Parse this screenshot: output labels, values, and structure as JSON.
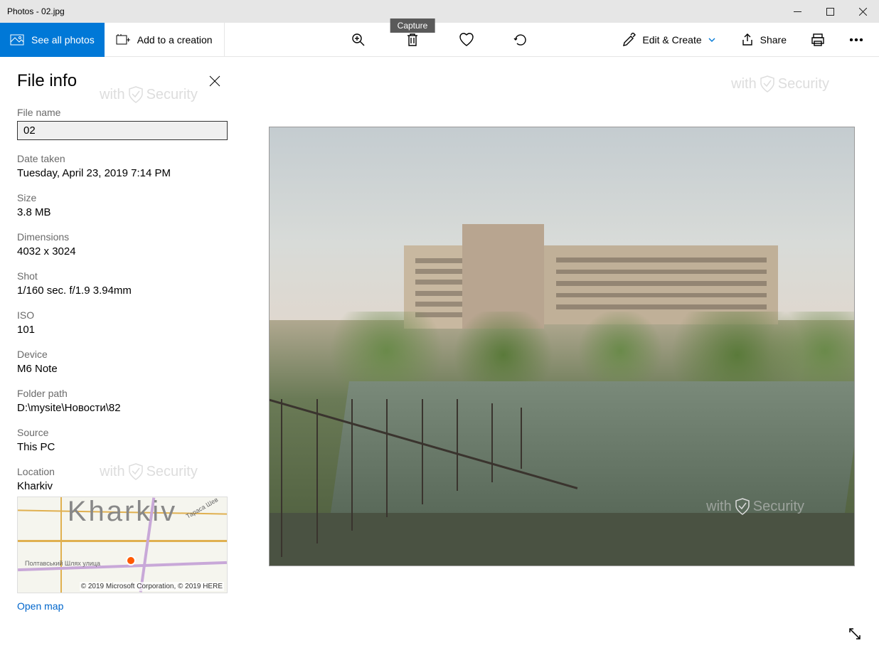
{
  "titlebar": {
    "title": "Photos - 02.jpg"
  },
  "toolbar": {
    "see_all": "See all photos",
    "add_creation": "Add to a creation",
    "capture_tooltip": "Capture",
    "edit_create": "Edit & Create",
    "share": "Share"
  },
  "fileinfo": {
    "title": "File info",
    "filename_label": "File name",
    "filename_value": "02",
    "date_label": "Date taken",
    "date_value": "Tuesday, April 23, 2019 7:14 PM",
    "size_label": "Size",
    "size_value": "3.8 MB",
    "dimensions_label": "Dimensions",
    "dimensions_value": "4032 x 3024",
    "shot_label": "Shot",
    "shot_value": "1/160 sec. f/1.9 3.94mm",
    "iso_label": "ISO",
    "iso_value": "101",
    "device_label": "Device",
    "device_value": "M6 Note",
    "folder_label": "Folder path",
    "folder_value": "D:\\mysite\\Новости\\82",
    "source_label": "Source",
    "source_value": "This PC",
    "location_label": "Location",
    "location_value": "Kharkiv",
    "map_city": "Kharkiv",
    "map_road_label1": "Полтавський Шлях улица",
    "map_road_label2": "Тараса Шев",
    "map_credit": "© 2019 Microsoft Corporation, © 2019 HERE",
    "open_map": "Open map"
  },
  "watermark": {
    "text_prefix": "with",
    "text_suffix": "Security"
  }
}
